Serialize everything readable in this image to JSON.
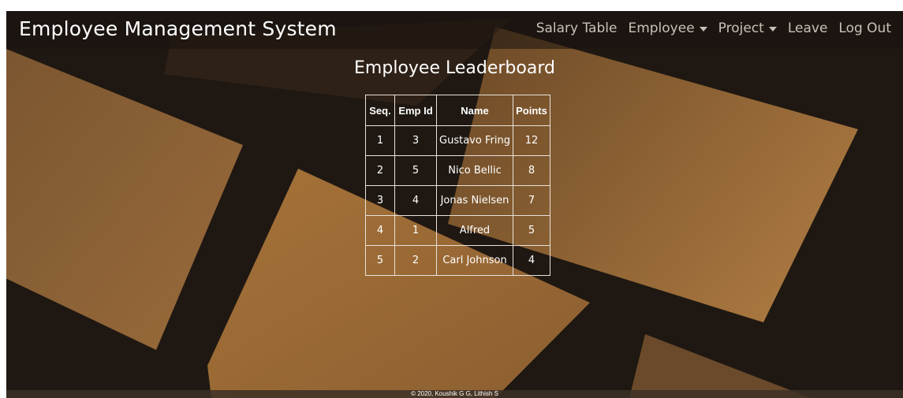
{
  "navbar": {
    "brand": "Employee Management System",
    "links": [
      {
        "label": "Salary Table"
      },
      {
        "label": "Employee"
      },
      {
        "label": "Project"
      },
      {
        "label": "Leave"
      },
      {
        "label": "Log Out"
      }
    ]
  },
  "main": {
    "title": "Employee Leaderboard",
    "table": {
      "headers": [
        "Seq.",
        "Emp Id",
        "Name",
        "Points"
      ],
      "rows": [
        [
          "1",
          "3",
          "Gustavo Fring",
          "12"
        ],
        [
          "2",
          "5",
          "Nico Bellic",
          "8"
        ],
        [
          "3",
          "4",
          "Jonas Nielsen",
          "7"
        ],
        [
          "4",
          "1",
          "Alfred",
          "5"
        ],
        [
          "5",
          "2",
          "Carl Johnson",
          "4"
        ]
      ]
    }
  },
  "footer": {
    "text": "© 2020, Koushik G G, Lithish S"
  },
  "colors": {
    "background_dark": "#1f1812",
    "card_brown": "#8a5f32",
    "nav_text": "#c9c1b7",
    "text": "#ffffff"
  }
}
